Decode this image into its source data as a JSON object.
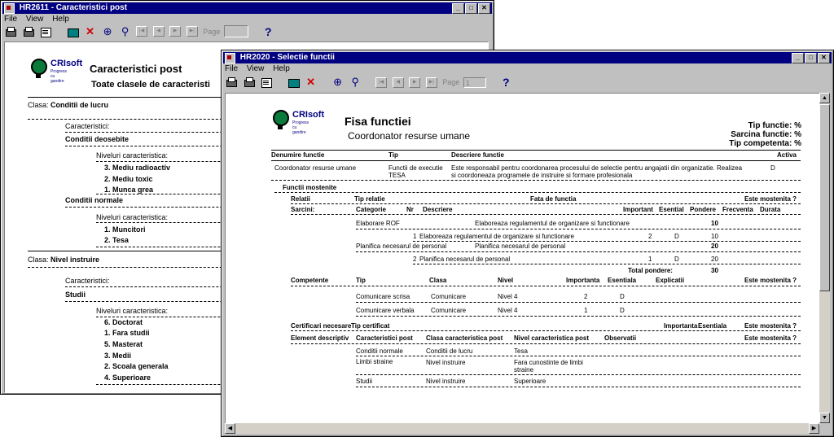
{
  "window1": {
    "title": "HR2611 - Caracteristici post",
    "menu": [
      "File",
      "View",
      "Help"
    ],
    "toolbar": {
      "page_label": "Page",
      "help": "?"
    },
    "report": {
      "logo": {
        "name": "CRIsoft",
        "tagline": "Progress cu gandire"
      },
      "title": "Caracteristici post",
      "subtitle": "Toate clasele de caracteristi",
      "classes": [
        {
          "label": "Clasa:",
          "name": "Conditii de lucru"
        },
        {
          "label": "Clasa:",
          "name": "Nivel instruire"
        }
      ],
      "caracteristici_label": "Caracteristici:",
      "niveluri_label": "Niveluri caracteristica:",
      "char1": {
        "name": "Conditii deosebite",
        "levels": [
          "3. Mediu radioactiv",
          "2. Mediu toxic",
          "1. Munca grea"
        ]
      },
      "char2": {
        "name": "Conditii normale",
        "levels": [
          "1. Muncitori",
          "2. Tesa"
        ]
      },
      "char3": {
        "name": "Studii",
        "levels": [
          "6. Doctorat",
          "1. Fara studii",
          "5. Masterat",
          "3. Medii",
          "2. Scoala generala",
          "4. Superioare"
        ]
      }
    }
  },
  "window2": {
    "title": "HR2020 - Selectie functii",
    "menu": [
      "File",
      "View",
      "Help"
    ],
    "toolbar": {
      "page_label": "Page",
      "page_value": "1",
      "help": "?"
    },
    "report": {
      "logo": {
        "name": "CRIsoft",
        "tagline": "Progress cu gandire"
      },
      "title": "Fisa functiei",
      "subtitle": "Coordonator resurse umane",
      "tip_functie": "Tip functie: %",
      "sarcina_functie": "Sarcina functie: %",
      "tip_competenta": "Tip competenta: %",
      "header": {
        "denumire": "Denumire functie",
        "tip": "Tip",
        "descriere": "Descriere functie",
        "activa": "Activa"
      },
      "row": {
        "denumire": "Coordonator resurse umane",
        "tip1": "Functii de executie",
        "tip2": "TESA",
        "desc1": "Este responsabil pentru coordonarea procesului de selectie pentru angajatii din organizatie. Realizea",
        "desc2": "si coordoneaza programele de instruire si formare profesionala",
        "activa": "D"
      },
      "functii_mostenite": "Functii mostenite",
      "relatii": {
        "label": "Relatii",
        "tip": "Tip relatie",
        "fata": "Fata de functia",
        "mostenita": "Este mostenita ?"
      },
      "sarcini_header": {
        "label": "Sarcini:",
        "categorie": "Categorie",
        "nr": "Nr",
        "descriere": "Descriere",
        "important": "Important",
        "esential": "Esential",
        "pondere": "Pondere",
        "frecventa": "Frecventa",
        "durata": "Durata"
      },
      "sarcini_groups": [
        {
          "categorie": "Elaborare ROF",
          "descriere": "Elaboreaza regulamentul de organizare si functionare",
          "pondere": "10",
          "items": [
            {
              "nr": "1",
              "descriere": "Elaboreaza regulamentul de organizare si functionare",
              "important": "2",
              "esential": "D",
              "pondere": "10"
            }
          ]
        },
        {
          "categorie": "Planifica necesarul de personal",
          "descriere": "Planifica necesarul de personal",
          "pondere": "20",
          "items": [
            {
              "nr": "2",
              "descriere": "Planifica necesarul de personal",
              "important": "1",
              "esential": "D",
              "pondere": "20"
            }
          ]
        }
      ],
      "total_label": "Total pondere:",
      "total_value": "30",
      "competente_header": {
        "label": "Competente",
        "tip": "Tip",
        "clasa": "Clasa",
        "nivel": "Nivel",
        "importanta": "Importanta",
        "esentiala": "Esentiala",
        "explicatii": "Explicatii",
        "mostenita": "Este mostenita ?"
      },
      "competente": [
        {
          "tip": "Comunicare scrisa",
          "clasa": "Comunicare",
          "nivel": "Nivel 4",
          "importanta": "2",
          "esentiala": "D"
        },
        {
          "tip": "Comunicare verbala",
          "clasa": "Comunicare",
          "nivel": "Nivel 4",
          "importanta": "1",
          "esentiala": "D"
        }
      ],
      "certificari": {
        "label": "Certificari necesare",
        "tip": "Tip certificat",
        "importanta": "Importanta",
        "esentiala": "Esentiala",
        "mostenita": "Este mostenita ?"
      },
      "elemente_header": {
        "label": "Element descriptiv",
        "caract": "Caracteristici post",
        "clasa": "Clasa caracteristica post",
        "nivel": "Nivel caracteristica post",
        "observatii": "Observatii",
        "mostenita": "Este mostenita ?"
      },
      "elemente": [
        {
          "caract": "Conditii normale",
          "clasa": "Conditii de lucru",
          "nivel1": "Tesa",
          "nivel2": ""
        },
        {
          "caract": "Limbi straine",
          "clasa": "Nivel instruire",
          "nivel1": "Fara cunostinte de limbi",
          "nivel2": "straine"
        },
        {
          "caract": "Studii",
          "clasa": "Nivel instruire",
          "nivel1": "Superioare",
          "nivel2": ""
        }
      ]
    }
  }
}
